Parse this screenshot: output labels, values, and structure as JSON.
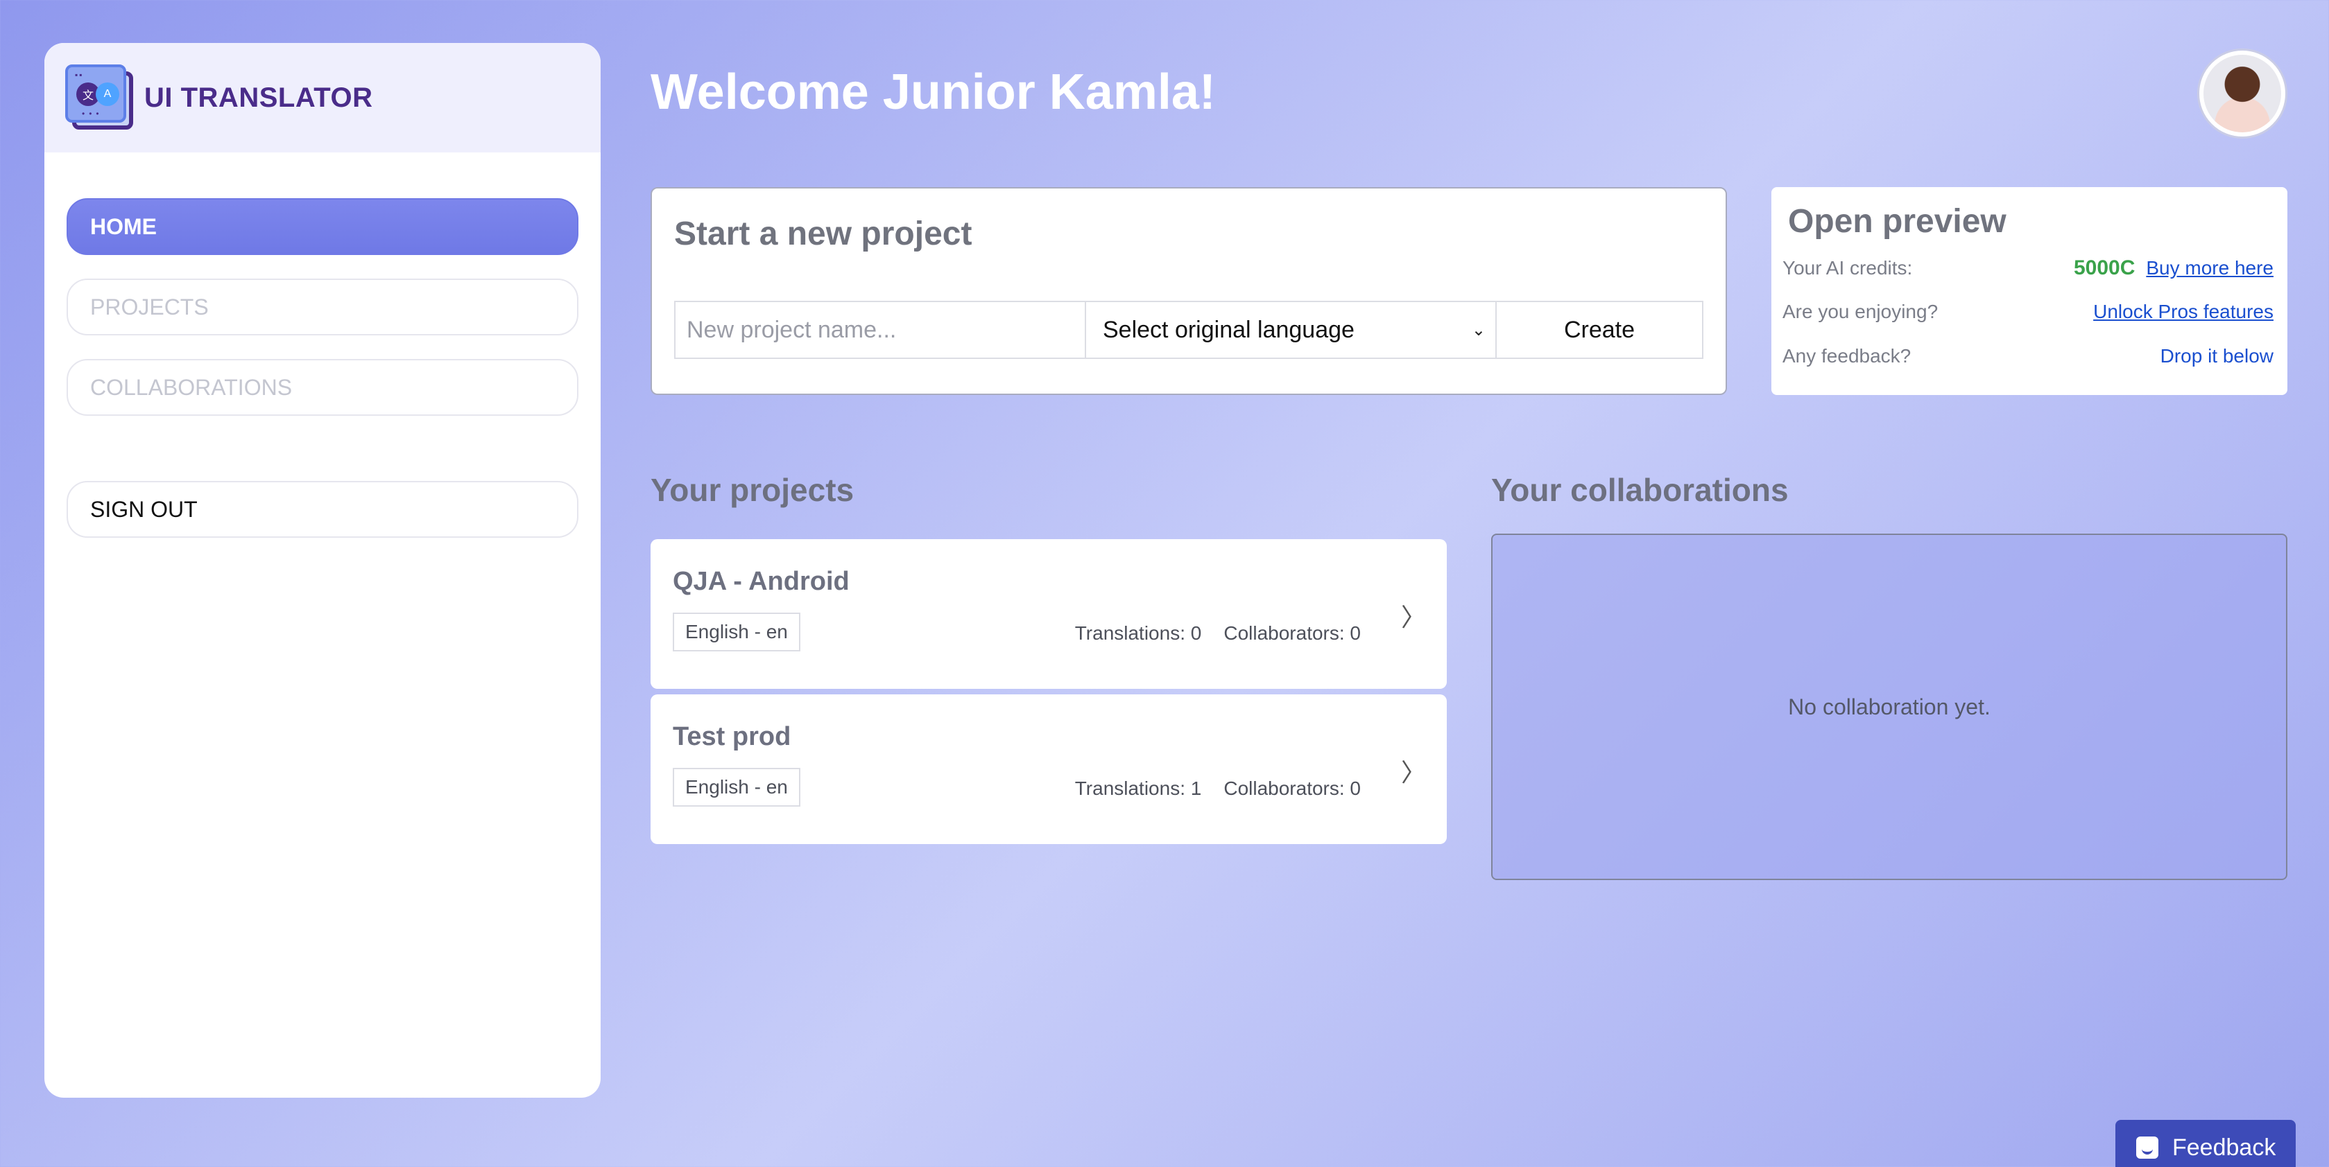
{
  "brand": {
    "name": "UI TRANSLATOR"
  },
  "nav": {
    "home": "HOME",
    "projects": "PROJECTS",
    "collaborations": "COLLABORATIONS",
    "signout": "SIGN OUT"
  },
  "header": {
    "welcome": "Welcome Junior Kamla!"
  },
  "new_project": {
    "title": "Start a new project",
    "name_placeholder": "New project name...",
    "language_select": "Select original language",
    "create_label": "Create"
  },
  "preview": {
    "title": "Open preview",
    "credits_label": "Your AI credits:",
    "credits_value": "5000C",
    "buy_link": "Buy more here",
    "enjoy_label": "Are you enjoying?",
    "unlock_link": "Unlock Pros features",
    "feedback_label": "Any feedback?",
    "drop_link": "Drop it below"
  },
  "projects": {
    "title": "Your projects",
    "items": [
      {
        "name": "QJA - Android",
        "language": "English - en",
        "translations": "Translations: 0",
        "collaborators": "Collaborators: 0"
      },
      {
        "name": "Test prod",
        "language": "English - en",
        "translations": "Translations: 1",
        "collaborators": "Collaborators: 0"
      }
    ]
  },
  "collaborations": {
    "title": "Your collaborations",
    "empty": "No collaboration yet."
  },
  "feedback_button": {
    "label": "Feedback"
  },
  "colors": {
    "accent": "#6f79e6",
    "brand": "#4a2c8a",
    "credits": "#3aa24a",
    "link": "#1a4fcf",
    "feedback_bg": "#3d4bb8"
  }
}
